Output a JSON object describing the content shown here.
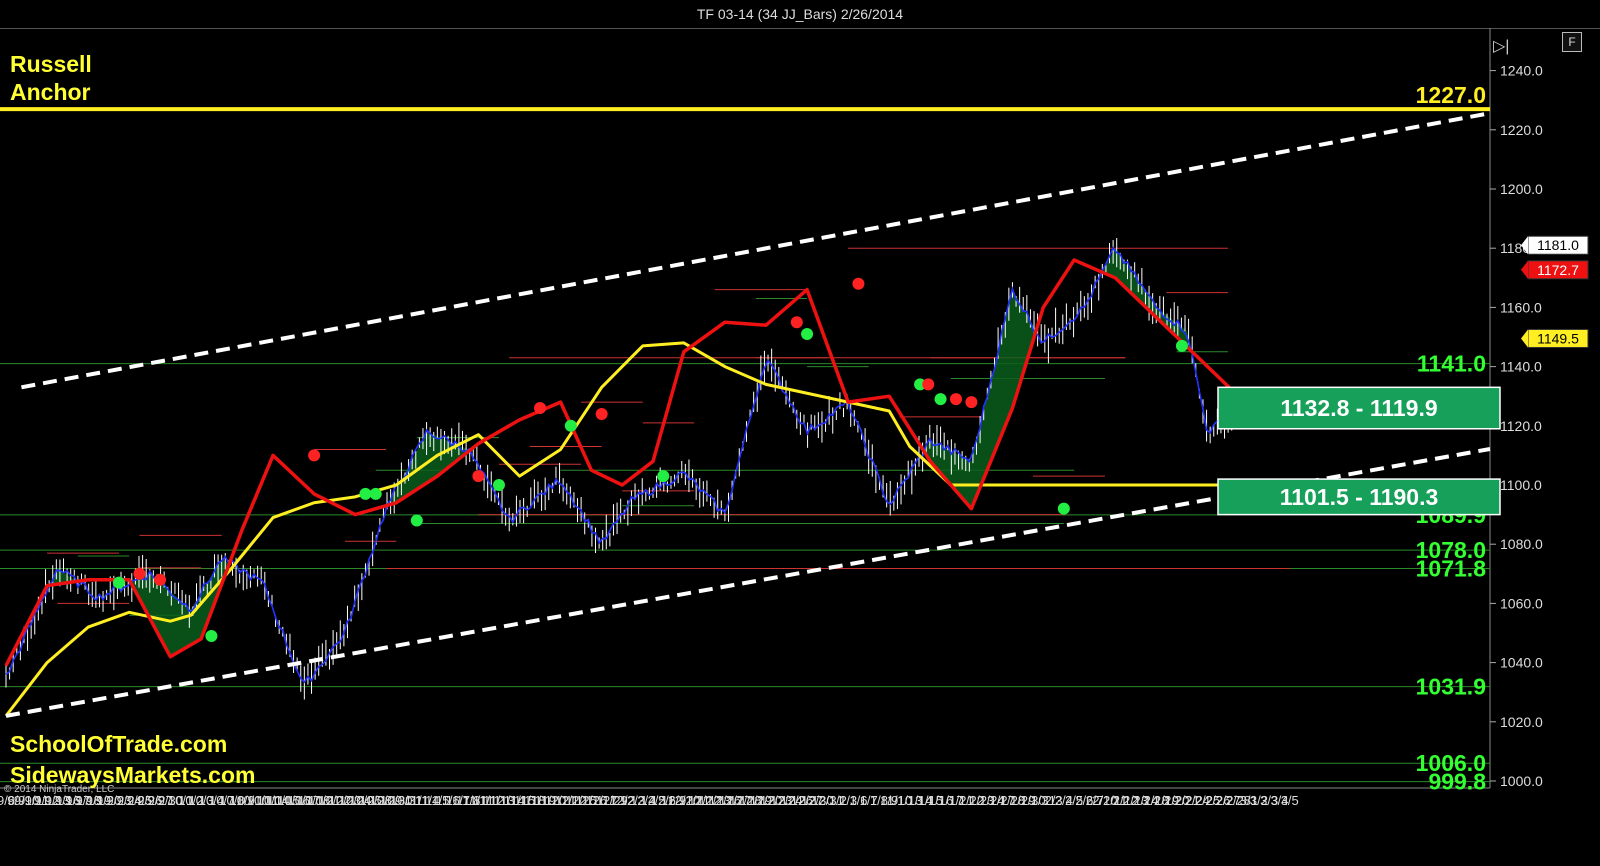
{
  "window": {
    "title": "TF 03-14 (34 JJ_Bars)  2/26/2014"
  },
  "labels": {
    "instrument_line1": "Russell",
    "instrument_line2": "Anchor",
    "watermark1": "SchoolOfTrade.com",
    "watermark2": "SidewaysMarkets.com",
    "copyright": "© 2014 NinjaTrader, LLC",
    "button_f": "F"
  },
  "colors": {
    "background": "#000000",
    "price_bars": "#ffffff",
    "fast_line": "#2233ff",
    "red_ma": "#ee1111",
    "yellow_ma": "#ffee22",
    "fill_green": "#0b5e1c",
    "level_text": "#33ff33",
    "zone_fill": "#17a05a",
    "dot_green": "#22ee44",
    "dot_red": "#ff2222"
  },
  "chart_data": {
    "type": "line",
    "ylim": [
      997,
      1252
    ],
    "yticks": [
      "1000.0",
      "1020.0",
      "1040.0",
      "1060.0",
      "1080.0",
      "1100.0",
      "1120.0",
      "1140.0",
      "1160.0",
      "1180.0",
      "1200.0",
      "1220.0",
      "1240.0"
    ],
    "x_labels": [
      "9/6",
      "9/9",
      "9/10",
      "9/11",
      "9/12",
      "9/13",
      "9/16",
      "9/17",
      "9/18",
      "9/19",
      "9/20",
      "9/23",
      "9/24",
      "9/25",
      "9/26",
      "9/27",
      "9/30",
      "10/1",
      "10/2",
      "10/3",
      "10/4",
      "10/7",
      "10/8",
      "10/9",
      "10/10",
      "10/11",
      "10/14",
      "10/15",
      "10/16",
      "10/17",
      "10/18",
      "10/21",
      "10/22",
      "10/23",
      "10/24",
      "10/25",
      "10/28",
      "10/29",
      "10/30",
      "10/31",
      "11/1",
      "11/4",
      "11/5",
      "11/6",
      "11/7",
      "11/8",
      "11/11",
      "11/12",
      "11/13",
      "11/14",
      "11/15",
      "11/18",
      "11/19",
      "11/20",
      "11/21",
      "11/22",
      "11/25",
      "11/26",
      "11/27",
      "11/29",
      "12/2",
      "12/3",
      "12/4",
      "12/5",
      "12/6",
      "12/9",
      "12/10",
      "12/11",
      "12/12",
      "12/13",
      "12/16",
      "12/17",
      "12/18",
      "12/19",
      "12/20",
      "12/23",
      "12/24",
      "12/26",
      "12/27",
      "12/30",
      "12/31",
      "1/2",
      "1/3",
      "1/6",
      "1/7",
      "1/8",
      "1/9",
      "1/10",
      "1/13",
      "1/14",
      "1/15",
      "1/16",
      "1/17",
      "1/21",
      "1/22",
      "1/23",
      "1/24",
      "1/27",
      "1/28",
      "1/29",
      "1/30",
      "1/31",
      "2/3",
      "2/4",
      "2/5",
      "2/6",
      "2/7",
      "2/10",
      "2/11",
      "2/12",
      "2/13",
      "2/14",
      "2/18",
      "2/19",
      "2/20",
      "2/21",
      "2/24",
      "2/25",
      "2/26",
      "2/27",
      "2/28",
      "3/1",
      "3/2",
      "3/3",
      "3/4",
      "3/5"
    ],
    "price": {
      "name": "TF 03-14",
      "x": [
        0,
        5,
        9,
        14,
        18,
        21,
        25,
        29,
        33,
        37,
        41,
        45,
        49,
        54,
        58,
        61,
        66,
        70,
        74,
        78,
        82,
        86,
        90,
        94,
        98,
        101,
        105,
        108,
        112,
        115,
        117,
        121,
        125
      ],
      "y": [
        1035,
        1072,
        1062,
        1070,
        1058,
        1075,
        1067,
        1032,
        1050,
        1092,
        1118,
        1112,
        1088,
        1102,
        1080,
        1095,
        1104,
        1090,
        1143,
        1118,
        1128,
        1093,
        1115,
        1108,
        1166,
        1148,
        1160,
        1180,
        1160,
        1152,
        1118,
        1128,
        1098
      ],
      "notes": ""
    },
    "series": [
      {
        "name": "",
        "color": "#ee1111",
        "x": [
          0,
          4,
          8,
          12,
          16,
          19,
          23,
          26,
          30,
          34,
          38,
          42,
          46,
          50,
          54,
          57,
          60,
          63,
          66,
          70,
          74,
          78,
          82,
          86,
          90,
          94,
          98,
          101,
          104,
          108,
          111,
          114,
          117,
          120,
          122
        ],
        "y": [
          1039,
          1066,
          1068,
          1068,
          1042,
          1048,
          1085,
          1110,
          1097,
          1090,
          1094,
          1103,
          1114,
          1122,
          1128,
          1105,
          1100,
          1108,
          1145,
          1155,
          1154,
          1166,
          1128,
          1130,
          1108,
          1092,
          1126,
          1160,
          1176,
          1170,
          1160,
          1150,
          1140,
          1130,
          1120
        ]
      },
      {
        "name": "",
        "color": "#ffee22",
        "x": [
          0,
          4,
          8,
          12,
          16,
          18,
          22,
          26,
          30,
          34,
          38,
          42,
          46,
          50,
          54,
          58,
          62,
          66,
          70,
          74,
          78,
          82,
          86,
          88,
          92,
          96,
          100,
          104,
          108,
          112,
          116,
          118,
          120,
          122
        ],
        "y": [
          1022,
          1040,
          1052,
          1057,
          1054,
          1056,
          1072,
          1089,
          1094,
          1096,
          1100,
          1110,
          1117,
          1103,
          1112,
          1133,
          1147,
          1148,
          1140,
          1134,
          1131,
          1128,
          1125,
          1113,
          1100,
          1100,
          1100,
          1100,
          1100,
          1100,
          1100,
          1100,
          1100,
          1100
        ]
      }
    ],
    "channel_upper": {
      "from": [
        1.5,
        1133
      ],
      "to": [
        125,
        1213
      ]
    },
    "channel_lower": {
      "from": [
        0,
        1022
      ],
      "to": [
        125,
        1100
      ]
    },
    "levels": [
      {
        "price": 1227.0,
        "label": "1227.0",
        "style": "yellow-thick"
      },
      {
        "price": 1141.0,
        "label": "1141.0"
      },
      {
        "price": 1089.9,
        "label": "1089.9"
      },
      {
        "price": 1078.0,
        "label": "1078.0"
      },
      {
        "price": 1071.8,
        "label": "1071.8"
      },
      {
        "price": 1031.9,
        "label": "1031.9"
      },
      {
        "price": 1006.0,
        "label": "1006.0"
      },
      {
        "price": 999.8,
        "label": "999.8"
      }
    ],
    "zones": [
      {
        "label": "1132.8 - 1119.9",
        "top": 1133,
        "bottom": 1119
      },
      {
        "label": "1101.5 - 1190.3",
        "top": 1102,
        "bottom": 1090
      }
    ],
    "price_tags": [
      {
        "value": "1181.0",
        "price": 1181.0,
        "bg": "#ffffff",
        "fg": "#000000"
      },
      {
        "value": "1172.7",
        "price": 1172.7,
        "bg": "#ee1111",
        "fg": "#ffffff"
      },
      {
        "value": "1149.5",
        "price": 1149.5,
        "bg": "#ffee22",
        "fg": "#000000"
      }
    ],
    "dots": [
      {
        "x": 11,
        "y": 1067,
        "c": "g"
      },
      {
        "x": 13,
        "y": 1070,
        "c": "r"
      },
      {
        "x": 15,
        "y": 1068,
        "c": "r"
      },
      {
        "x": 20,
        "y": 1049,
        "c": "g"
      },
      {
        "x": 30,
        "y": 1110,
        "c": "r"
      },
      {
        "x": 35,
        "y": 1097,
        "c": "g"
      },
      {
        "x": 36,
        "y": 1097,
        "c": "g"
      },
      {
        "x": 40,
        "y": 1088,
        "c": "g"
      },
      {
        "x": 46,
        "y": 1103,
        "c": "r"
      },
      {
        "x": 48,
        "y": 1100,
        "c": "g"
      },
      {
        "x": 52,
        "y": 1126,
        "c": "r"
      },
      {
        "x": 55,
        "y": 1120,
        "c": "g"
      },
      {
        "x": 58,
        "y": 1124,
        "c": "r"
      },
      {
        "x": 64,
        "y": 1103,
        "c": "g"
      },
      {
        "x": 77,
        "y": 1155,
        "c": "r"
      },
      {
        "x": 78,
        "y": 1151,
        "c": "g"
      },
      {
        "x": 83,
        "y": 1168,
        "c": "r"
      },
      {
        "x": 89,
        "y": 1134,
        "c": "g"
      },
      {
        "x": 89.8,
        "y": 1134,
        "c": "r"
      },
      {
        "x": 91,
        "y": 1129,
        "c": "g"
      },
      {
        "x": 92.5,
        "y": 1129,
        "c": "r"
      },
      {
        "x": 94,
        "y": 1128,
        "c": "r"
      },
      {
        "x": 103,
        "y": 1092,
        "c": "g"
      },
      {
        "x": 114.5,
        "y": 1147,
        "c": "g"
      }
    ],
    "swing_lines": [
      {
        "p": 1077,
        "a": 4,
        "b": 11
      },
      {
        "p": 1076,
        "a": 7,
        "b": 12
      },
      {
        "p": 1072,
        "a": 13,
        "b": 19
      },
      {
        "p": 1060,
        "a": 5,
        "b": 12
      },
      {
        "p": 1056,
        "a": 12,
        "b": 18
      },
      {
        "p": 1083,
        "a": 13,
        "b": 21
      },
      {
        "p": 1112,
        "a": 30,
        "b": 37
      },
      {
        "p": 1105,
        "a": 36,
        "b": 43
      },
      {
        "p": 1081,
        "a": 33,
        "b": 38
      },
      {
        "p": 1071.8,
        "a": 37,
        "b": 125
      },
      {
        "p": 1116,
        "a": 40,
        "b": 48
      },
      {
        "p": 1107,
        "a": 48,
        "b": 56
      },
      {
        "p": 1090,
        "a": 46,
        "b": 103
      },
      {
        "p": 1087,
        "a": 40,
        "b": 103
      },
      {
        "p": 1143,
        "a": 49,
        "b": 109
      },
      {
        "p": 1113,
        "a": 51,
        "b": 58
      },
      {
        "p": 1105,
        "a": 54,
        "b": 104
      },
      {
        "p": 1128,
        "a": 56,
        "b": 62
      },
      {
        "p": 1098,
        "a": 60,
        "b": 67
      },
      {
        "p": 1093,
        "a": 60,
        "b": 67
      },
      {
        "p": 1121,
        "a": 62,
        "b": 67
      },
      {
        "p": 1166,
        "a": 69,
        "b": 78
      },
      {
        "p": 1163,
        "a": 73,
        "b": 78
      },
      {
        "p": 1143,
        "a": 73,
        "b": 80
      },
      {
        "p": 1180,
        "a": 82,
        "b": 119
      },
      {
        "p": 1140,
        "a": 78,
        "b": 84
      },
      {
        "p": 1123,
        "a": 87,
        "b": 95
      },
      {
        "p": 1143,
        "a": 90,
        "b": 109
      },
      {
        "p": 1136,
        "a": 92,
        "b": 107
      },
      {
        "p": 1103,
        "a": 100,
        "b": 107
      },
      {
        "p": 1165,
        "a": 113,
        "b": 119
      },
      {
        "p": 1145,
        "a": 114,
        "b": 119
      }
    ]
  }
}
